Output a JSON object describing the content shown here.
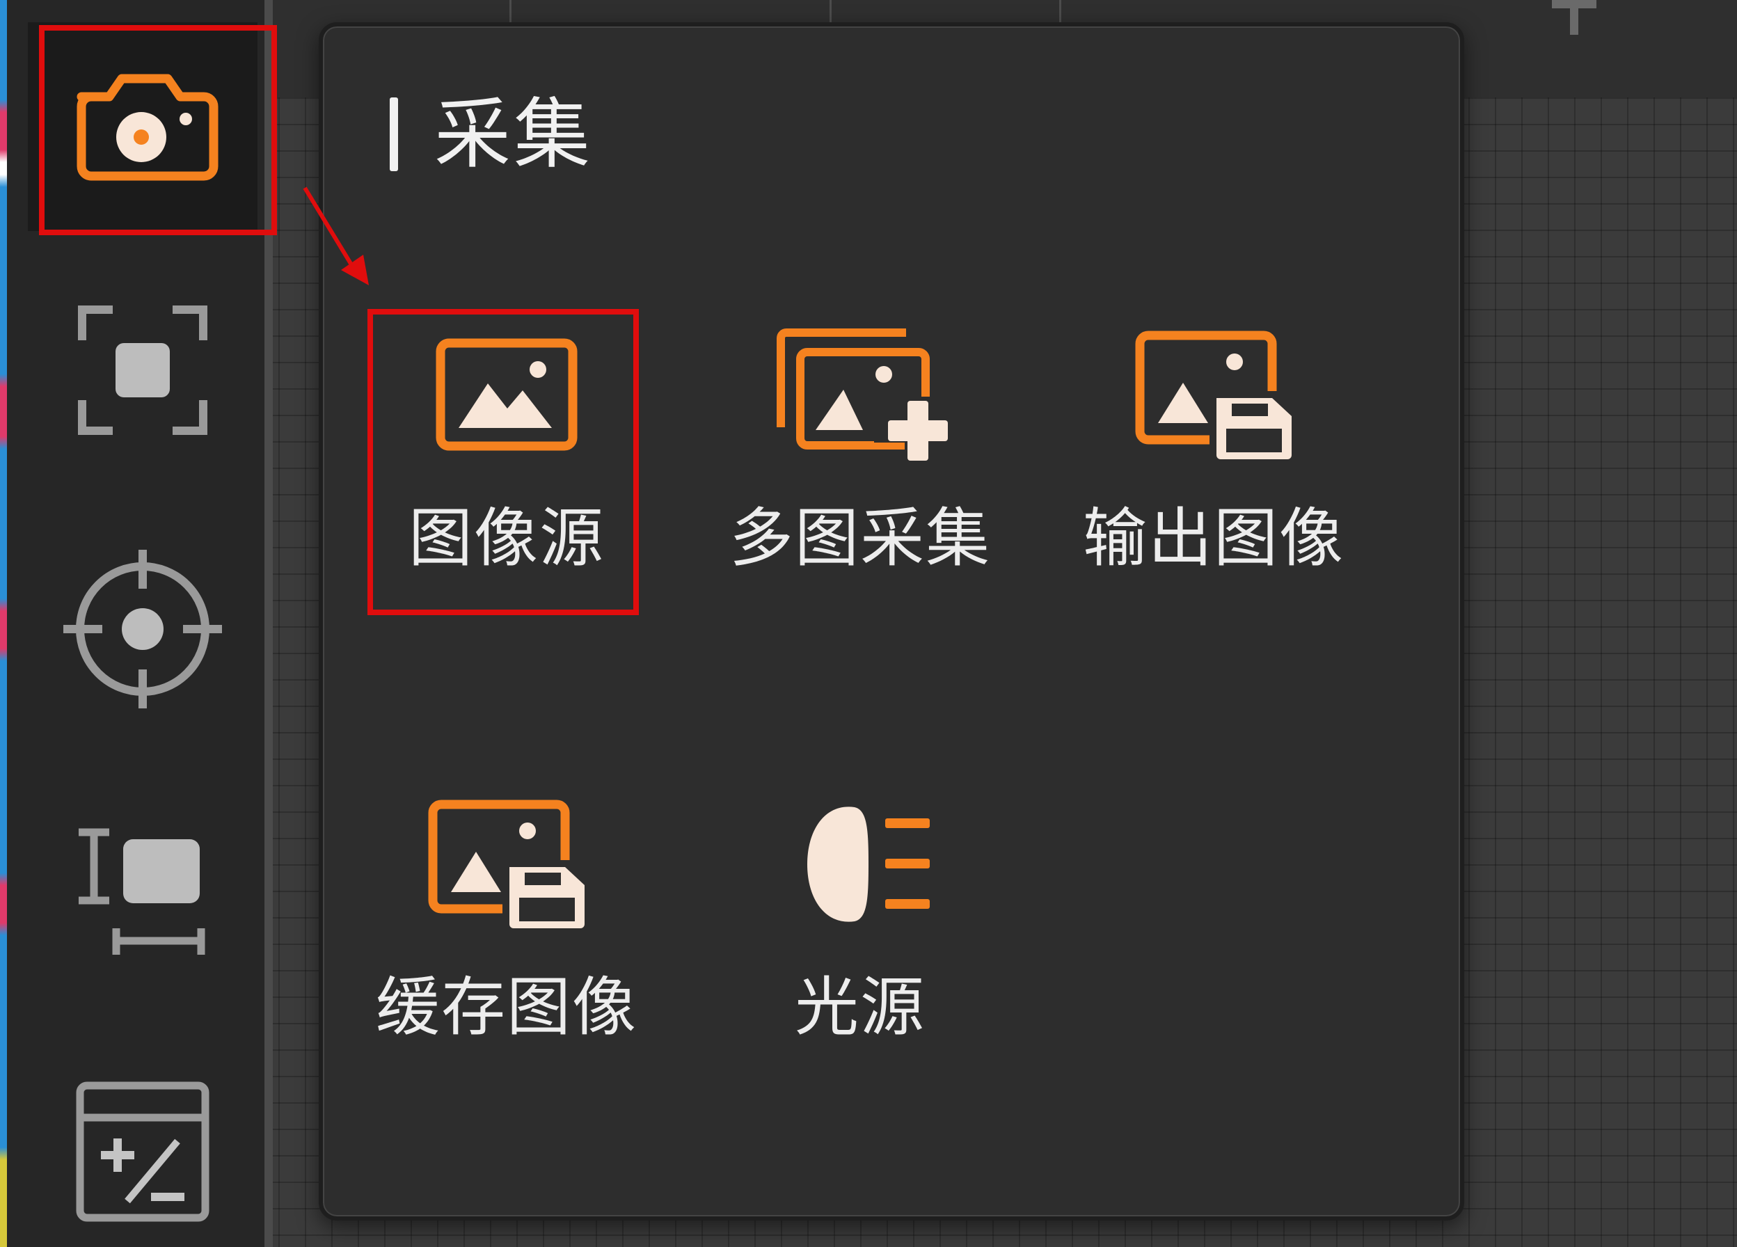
{
  "sidebar": {
    "items": [
      {
        "icon": "camera-icon",
        "active": true
      },
      {
        "icon": "focus-frame-icon",
        "active": false
      },
      {
        "icon": "target-icon",
        "active": false
      },
      {
        "icon": "measure-icon",
        "active": false
      },
      {
        "icon": "calculator-icon",
        "active": false
      }
    ]
  },
  "popup": {
    "section_title": "采集",
    "tools": [
      {
        "label": "图像源",
        "icon": "image-source-icon",
        "highlighted": true
      },
      {
        "label": "多图采集",
        "icon": "multi-image-add-icon",
        "highlighted": false
      },
      {
        "label": "输出图像",
        "icon": "output-image-icon",
        "highlighted": false
      },
      {
        "label": "缓存图像",
        "icon": "cache-image-icon",
        "highlighted": false
      },
      {
        "label": "光源",
        "icon": "light-source-icon",
        "highlighted": false
      }
    ]
  },
  "colors": {
    "accent_orange": "#f5821f",
    "icon_light": "#f8e6d8",
    "highlight_red": "#e00d0d",
    "panel_bg": "#2d2d2d",
    "sidebar_bg": "#262626"
  }
}
